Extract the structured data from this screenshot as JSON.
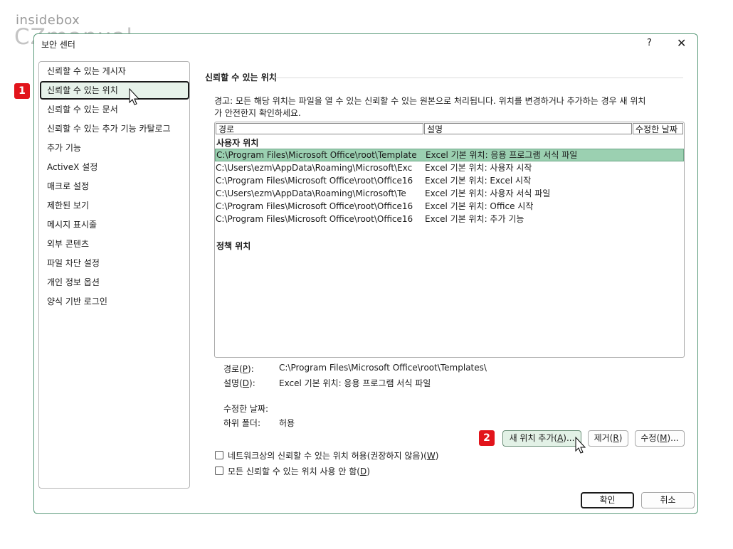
{
  "watermark": {
    "line1": "insidebox",
    "line2": "CZmanual"
  },
  "dialog": {
    "title": "보안 센터",
    "help": "?",
    "close": "✕"
  },
  "sidebar": {
    "items": [
      {
        "label": "신뢰할 수 있는 게시자"
      },
      {
        "label": "신뢰할 수 있는 위치"
      },
      {
        "label": "신뢰할 수 있는 문서"
      },
      {
        "label": "신뢰할 수 있는 추가 기능 카탈로그"
      },
      {
        "label": "추가 기능"
      },
      {
        "label": "ActiveX 설정"
      },
      {
        "label": "매크로 설정"
      },
      {
        "label": "제한된 보기"
      },
      {
        "label": "메시지 표시줄"
      },
      {
        "label": "외부 콘텐츠"
      },
      {
        "label": "파일 차단 설정"
      },
      {
        "label": "개인 정보 옵션"
      },
      {
        "label": "양식 기반 로그인"
      }
    ],
    "selected_index": 1
  },
  "steps": {
    "one": "1",
    "two": "2"
  },
  "main": {
    "section_title": "신뢰할 수 있는 위치",
    "warning_line1": "경고: 모든 해당 위치는 파일을 열 수 있는 신뢰할 수 있는 원본으로 처리됩니다. 위치를 변경하거나 추가하는 경우 새 위치",
    "warning_line2": "가 안전한지 확인하세요.",
    "columns": {
      "path": "경로",
      "description": "설명",
      "modified": "수정한 날짜"
    },
    "user_group": "사용자 위치",
    "policy_group": "정책 위치",
    "rows": [
      {
        "path": "C:\\Program Files\\Microsoft Office\\root\\Template",
        "description": "Excel 기본 위치: 응용 프로그램 서식 파일",
        "selected": true
      },
      {
        "path": "C:\\Users\\ezm\\AppData\\Roaming\\Microsoft\\Exc",
        "description": "Excel 기본 위치: 사용자 시작",
        "selected": false
      },
      {
        "path": "C:\\Program Files\\Microsoft Office\\root\\Office16",
        "description": "Excel 기본 위치: Excel 시작",
        "selected": false
      },
      {
        "path": "C:\\Users\\ezm\\AppData\\Roaming\\Microsoft\\Te",
        "description": "Excel 기본 위치: 사용자 서식 파일",
        "selected": false
      },
      {
        "path": "C:\\Program Files\\Microsoft Office\\root\\Office16",
        "description": "Excel 기본 위치: Office 시작",
        "selected": false
      },
      {
        "path": "C:\\Program Files\\Microsoft Office\\root\\Office16",
        "description": "Excel 기본 위치: 추가 기능",
        "selected": false
      }
    ],
    "details": {
      "path_label": "경로(",
      "path_key": "P",
      "path_label_end": "):",
      "path_value": "C:\\Program Files\\Microsoft Office\\root\\Templates\\",
      "desc_label": "설명(",
      "desc_key": "D",
      "desc_label_end": "):",
      "desc_value": "Excel 기본 위치: 응용 프로그램 서식 파일",
      "modified_label": "수정한 날짜:",
      "subfolders_label": "하위 폴더:",
      "subfolders_value": "허용"
    },
    "buttons": {
      "add_label": "새 위치 추가(",
      "add_key": "A",
      "add_end": ")...",
      "remove_label": "제거(",
      "remove_key": "R",
      "remove_end": ")",
      "modify_label": "수정(",
      "modify_key": "M",
      "modify_end": ")..."
    },
    "checkbox_network": {
      "label": "네트워크상의 신뢰할 수 있는 위치 허용(권장하지 않음)(",
      "key": "W",
      "end": ")",
      "checked": false
    },
    "checkbox_disable": {
      "label": "모든 신뢰할 수 있는 위치 사용 안 함(",
      "key": "D",
      "end": ")",
      "checked": false
    }
  },
  "footer": {
    "ok_label": "확인",
    "cancel_label": "취소"
  }
}
